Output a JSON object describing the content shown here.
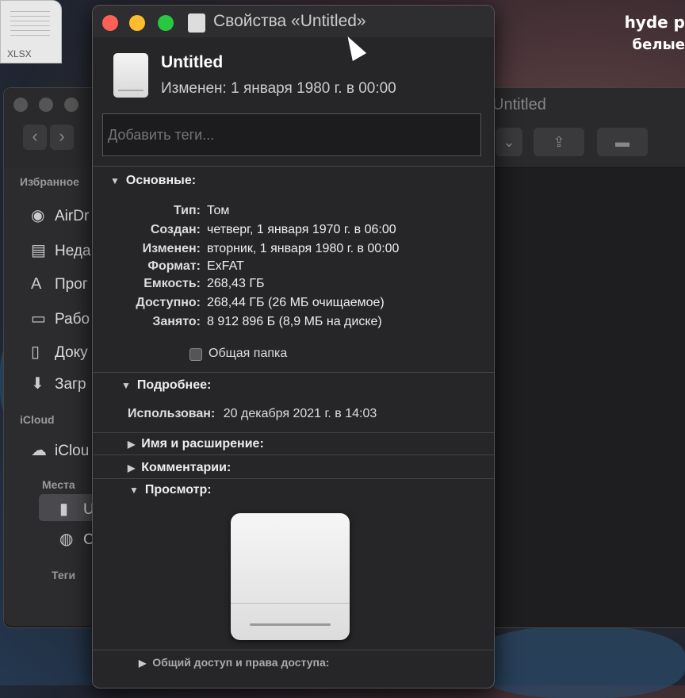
{
  "desktop": {
    "file_ext": "XLSX",
    "text_line1": "hyde p",
    "text_line2": "белые"
  },
  "finder": {
    "title": "Untitled",
    "sidebar": {
      "favorites_header": "Избранное",
      "items": [
        {
          "label": "AirDr",
          "icon": "airdrop-icon"
        },
        {
          "label": "Неда",
          "icon": "recents-icon"
        },
        {
          "label": "Прог",
          "icon": "applications-icon"
        },
        {
          "label": "Рабо",
          "icon": "desktop-icon"
        },
        {
          "label": "Доку",
          "icon": "documents-icon"
        },
        {
          "label": "Загр",
          "icon": "downloads-icon"
        }
      ],
      "icloud_header": "iCloud",
      "icloud_item": "iClou",
      "places_header": "Места",
      "places_items": [
        "Untit",
        "Сеть"
      ],
      "tags_header": "Теги"
    }
  },
  "info": {
    "window_title": "Свойства «Untitled»",
    "name": "Untitled",
    "modified_header": "Изменен: 1 января 1980 г. в 00:00",
    "tags_placeholder": "Добавить теги...",
    "general_section": "Основные:",
    "general_rows": [
      {
        "label": "Тип:",
        "value": "Том"
      },
      {
        "label": "Создан:",
        "value": "четверг, 1 января 1970 г. в 06:00"
      },
      {
        "label": "Изменен:",
        "value": "вторник, 1 января 1980 г. в 00:00"
      },
      {
        "label": "Формат:",
        "value": "ExFAT"
      },
      {
        "label": "Емкость:",
        "value": "268,43 ГБ"
      },
      {
        "label": "Доступно:",
        "value": "268,44 ГБ (26 МБ очищаемое)"
      },
      {
        "label": "Занято:",
        "value": "8 912 896 Б (8,9 МБ на диске)"
      }
    ],
    "shared_folder_label": "Общая папка",
    "more_info_section": "Подробнее:",
    "last_used_label": "Использован:",
    "last_used_value": "20 декабря 2021 г. в 14:03",
    "name_ext_section": "Имя и расширение:",
    "comments_section": "Комментарии:",
    "preview_section": "Просмотр:",
    "sharing_section": "Общий доступ и права доступа:"
  },
  "colors": {
    "close": "#fe5f57",
    "minimize": "#febc2e",
    "zoom": "#28c840"
  }
}
